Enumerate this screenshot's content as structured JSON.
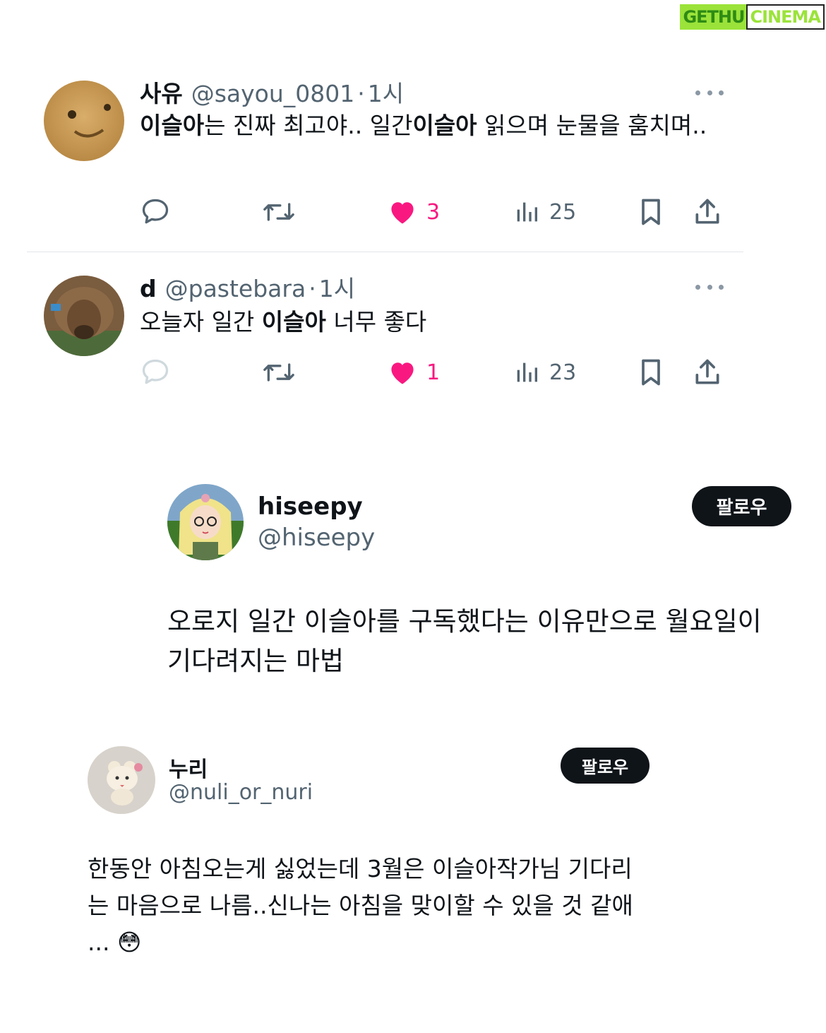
{
  "watermark": {
    "part1": "GETHU",
    "part2": "CINEMA"
  },
  "tweets": [
    {
      "name": "사유",
      "handle": "@sayou_0801",
      "separator": "·",
      "time": "1시",
      "text_segments": [
        {
          "text": "이슬아",
          "bold": true
        },
        {
          "text": "는 진짜 최고야.. 일간",
          "bold": false
        },
        {
          "text": "이슬아",
          "bold": true
        },
        {
          "text": " 읽으며 눈물을 훔치며..",
          "bold": false
        }
      ],
      "likes": "3",
      "views": "25"
    },
    {
      "name": "d",
      "handle": "@pastebara",
      "separator": "·",
      "time": "1시",
      "text_segments": [
        {
          "text": "오늘자 일간 ",
          "bold": false
        },
        {
          "text": "이슬아",
          "bold": true
        },
        {
          "text": " 너무 좋다",
          "bold": false
        }
      ],
      "likes": "1",
      "views": "23"
    }
  ],
  "card1": {
    "name": "hiseepy",
    "handle": "@hiseepy",
    "follow_label": "팔로우",
    "text": "오로지 일간 이슬아를 구독했다는 이유만으로 월요일이 기다려지는 마법"
  },
  "card2": {
    "name": "누리",
    "handle": "@nuli_or_nuri",
    "follow_label": "팔로우",
    "text": "한동안 아침오는게 싫었는데 3월은 이슬아작가님 기다리는 마음으로 나름..신나는 아침을 맞이할 수 있을 것 같애 ... 😳"
  },
  "icons": [
    "reply-icon",
    "retweet-icon",
    "heart-icon",
    "views-icon",
    "bookmark-icon",
    "share-icon",
    "more-icon"
  ],
  "colors": {
    "like": "#f91880",
    "secondary_text": "#536471",
    "follow_button": "#0f1419"
  }
}
